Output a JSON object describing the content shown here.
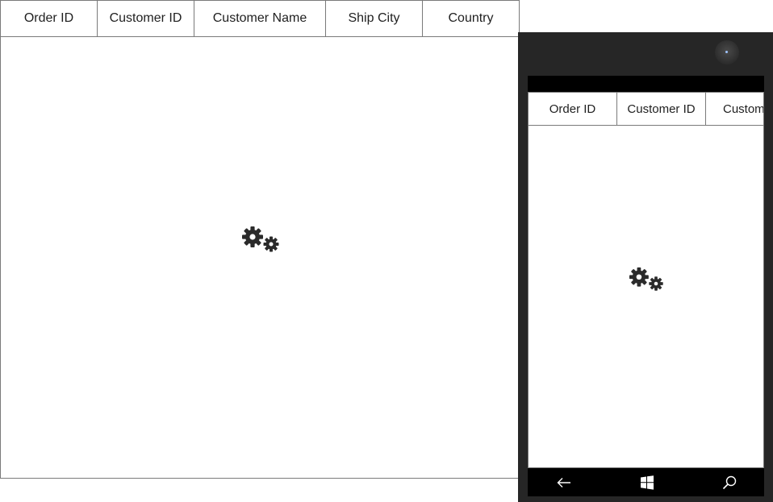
{
  "desktop_grid": {
    "columns": [
      "Order ID",
      "Customer ID",
      "Customer Name",
      "Ship City",
      "Country"
    ],
    "loading_indicator": "gears-icon"
  },
  "phone_emulator": {
    "grid": {
      "columns": [
        "Order ID",
        "Customer ID",
        "Customer Name"
      ],
      "loading_indicator": "gears-icon"
    },
    "nav_bar": {
      "back": "back-arrow-icon",
      "start": "windows-logo-icon",
      "search": "search-icon"
    },
    "colors": {
      "chrome": "#262626",
      "bars": "#000000"
    }
  }
}
